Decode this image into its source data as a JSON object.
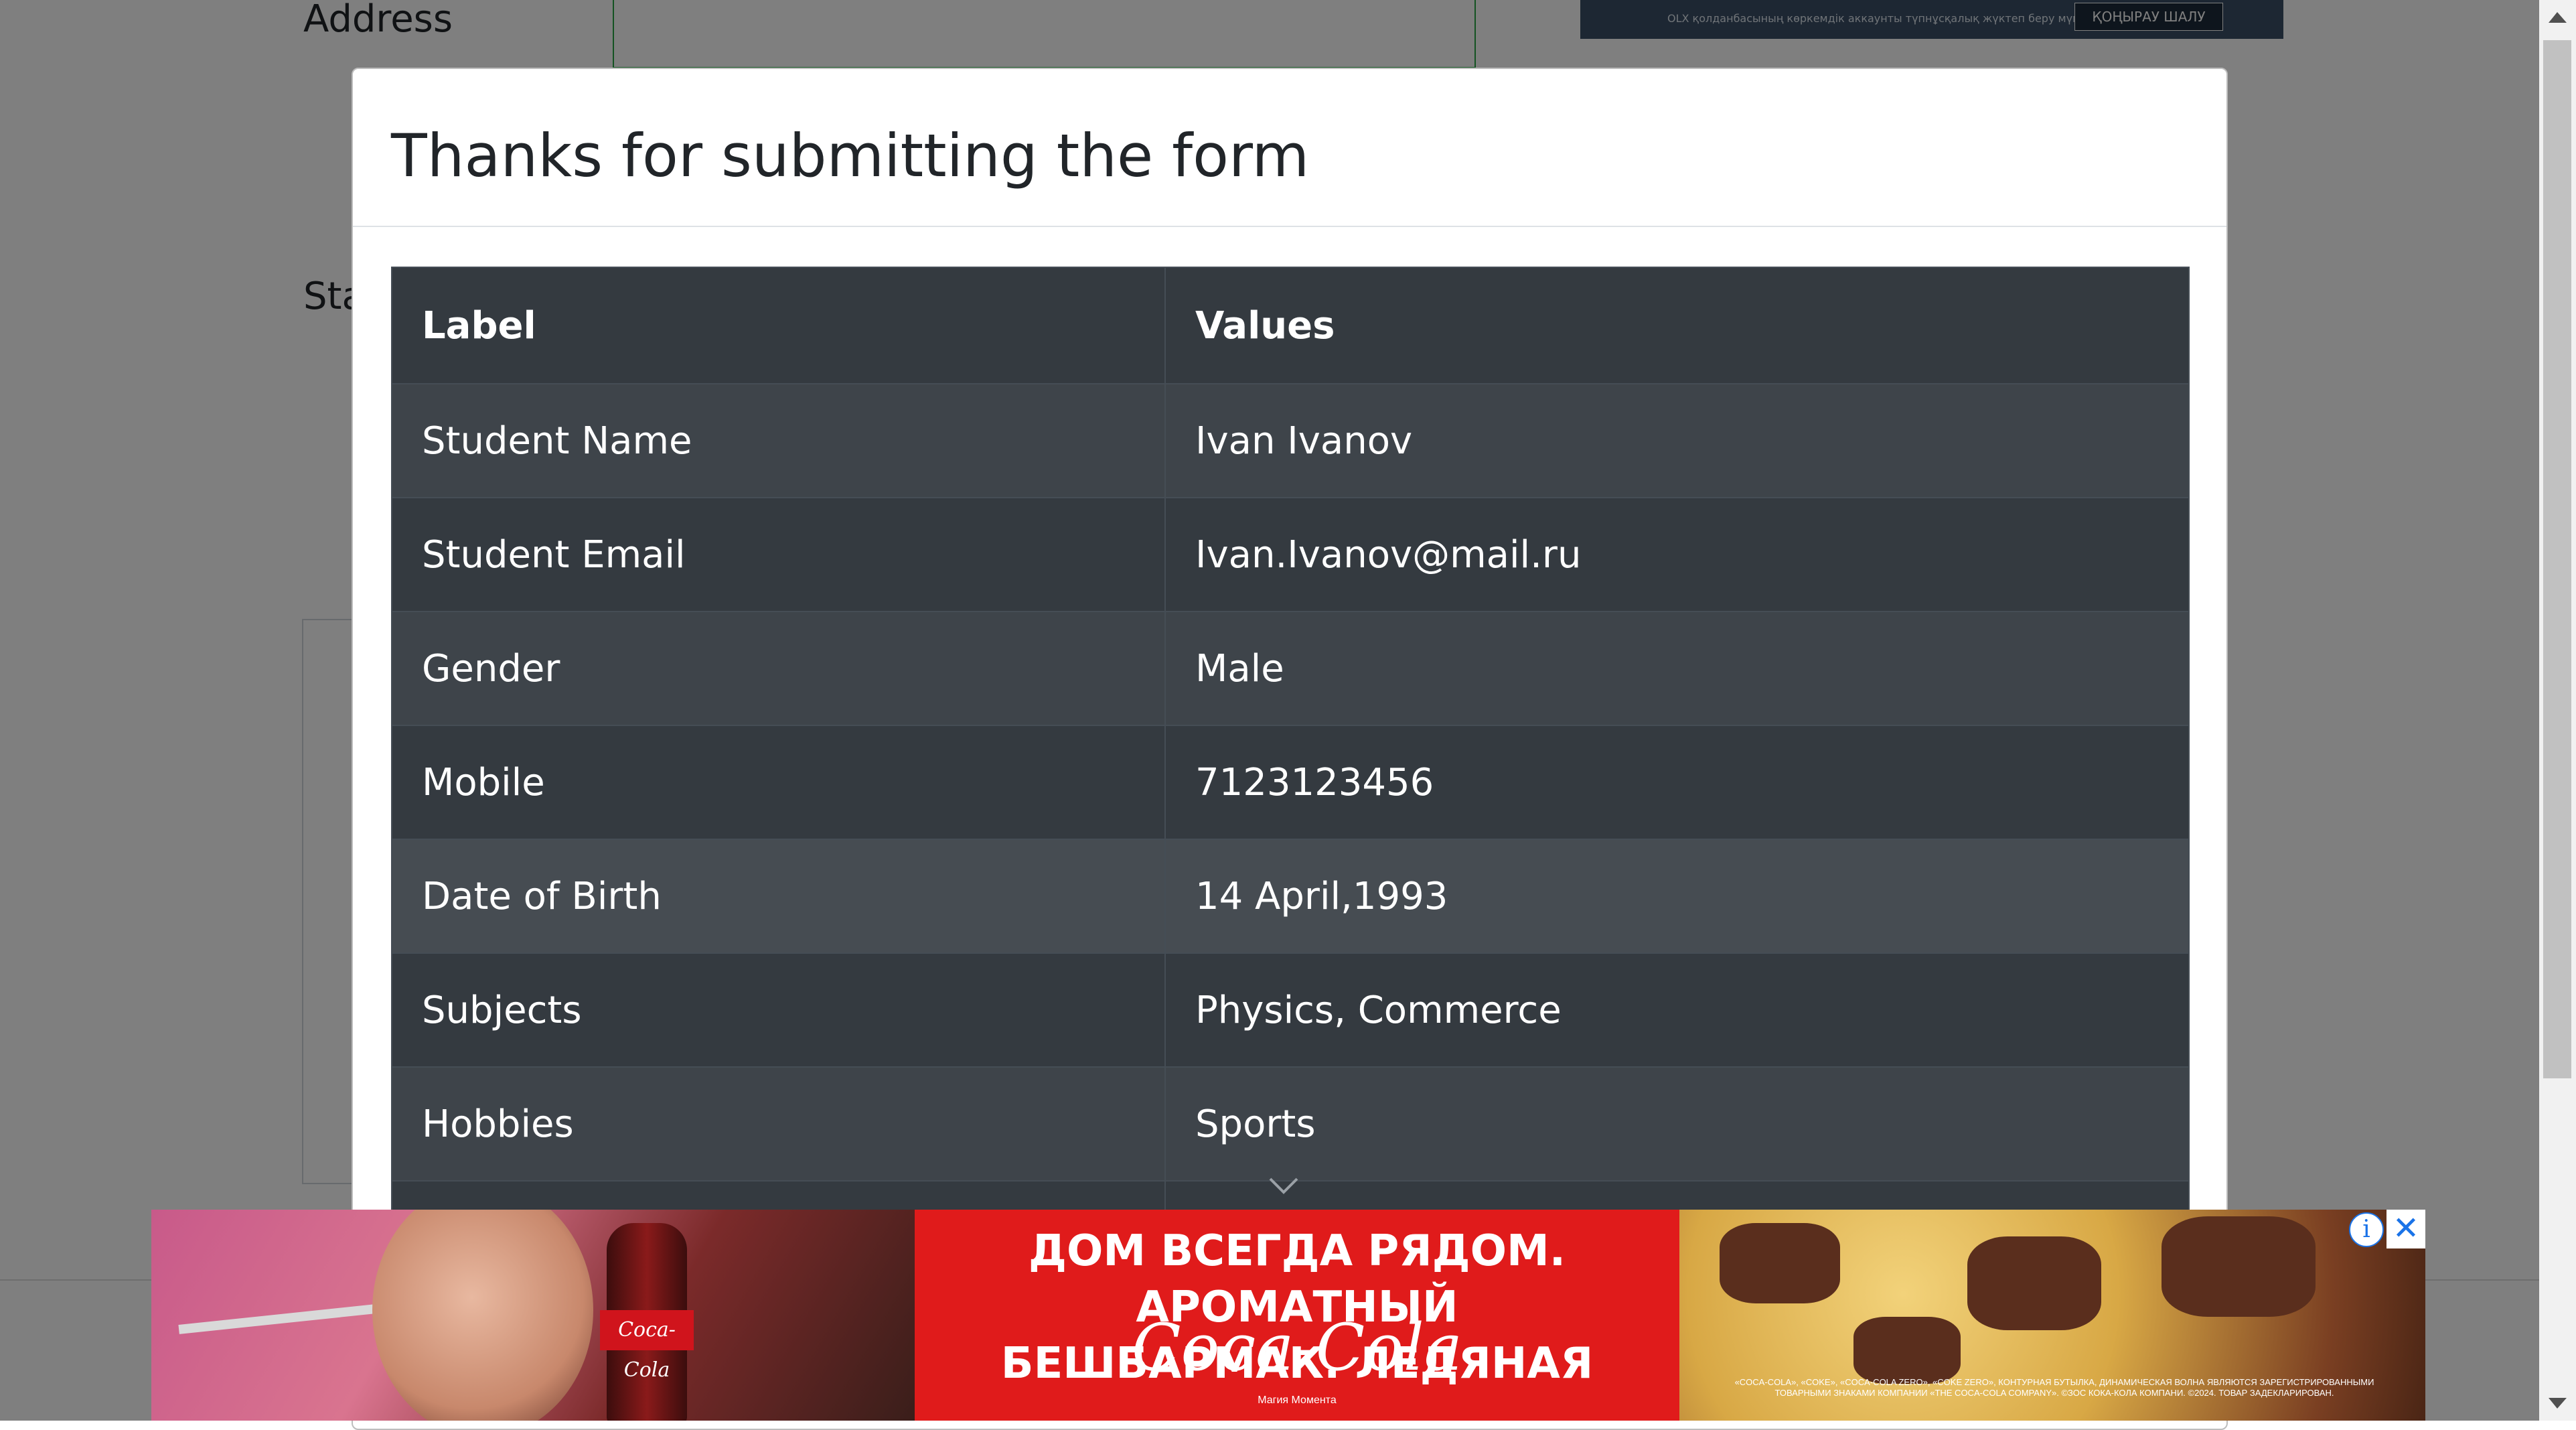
{
  "background_form": {
    "address_label": "Address",
    "state_label_partial": "Sta",
    "ad_top": {
      "text": "OLX қолданбасының көркемдік аккаунты түпнұсқалық жүктеп беру мүмк...",
      "button": "ҚОҢЫРАУ ШАЛУ"
    }
  },
  "modal": {
    "title": "Thanks for submitting the form",
    "table": {
      "headers": [
        "Label",
        "Values"
      ],
      "rows": [
        {
          "label": "Student Name",
          "value": "Ivan Ivanov"
        },
        {
          "label": "Student Email",
          "value": "Ivan.Ivanov@mail.ru"
        },
        {
          "label": "Gender",
          "value": "Male"
        },
        {
          "label": "Mobile",
          "value": "7123123456"
        },
        {
          "label": "Date of Birth",
          "value": "14 April,1993"
        },
        {
          "label": "Subjects",
          "value": "Physics, Commerce"
        },
        {
          "label": "Hobbies",
          "value": "Sports"
        }
      ]
    }
  },
  "ad_banner": {
    "headline_line1": "ДОМ ВСЕГДА РЯДОМ. АРОМАТНЫЙ",
    "headline_line2": "БЕШБАРМАК. ЛЕДЯНАЯ",
    "brand": "Coca-Cola",
    "slogan": "Магия Момента",
    "fine_print": "«COCA-COLA», «COKE», «COCA-COLA ZERO», «COKE ZERO», КОНТУРНАЯ БУТЫЛКА, ДИНАМИЧЕСКАЯ ВОЛНА ЯВЛЯЮТСЯ ЗАРЕГИСТРИРОВАННЫМИ ТОВАРНЫМИ ЗНАКАМИ КОМПАНИИ «THE COCA-COLA COMPANY». ©ЗОС КОКА-КОЛА КОМПАНИ. ©2024. ТОВАР ЗАДЕКЛАРИРОВАН.",
    "info_icon": "info-icon",
    "close_icon": "close-icon"
  },
  "colors": {
    "table_header_bg": "#343a40",
    "table_row_odd": "#3e444a",
    "table_row_even": "#343a40",
    "table_row_hover": "#464c52",
    "ad_red": "#e01b1b",
    "valid_field_border": "#28a745"
  }
}
